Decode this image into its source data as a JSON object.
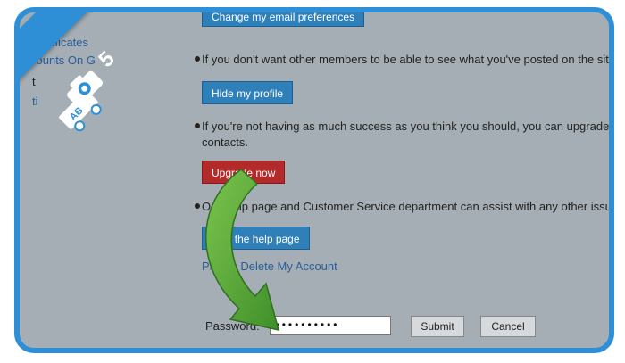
{
  "sidebar": {
    "items": [
      "Certificates",
      "counts On G",
      "t",
      "ti"
    ]
  },
  "top_button": {
    "label": "Change my email preferences"
  },
  "hide_section": {
    "text": "If you don't want other members to be able to see what you've posted on the site,",
    "button": "Hide my profile"
  },
  "upgrade_section": {
    "text_line1": "If you're not having as much success as you think you should, you can upgrade to",
    "text_line2": "contacts.",
    "button": "Upgrade now"
  },
  "help_section": {
    "text": "Our Help page and Customer Service department can assist with any other issues",
    "button": "Visit the help page"
  },
  "delete_link": "Please Delete My Account",
  "password_form": {
    "label": "Password:",
    "value": "••••••••••",
    "submit": "Submit",
    "cancel": "Cancel"
  },
  "overlay": {
    "step_number": "5",
    "logo_text": "AB",
    "colors": {
      "ribbon": "#2f8fd6",
      "arrow": "#5aa83a",
      "frame": "#2f8fd6"
    }
  }
}
